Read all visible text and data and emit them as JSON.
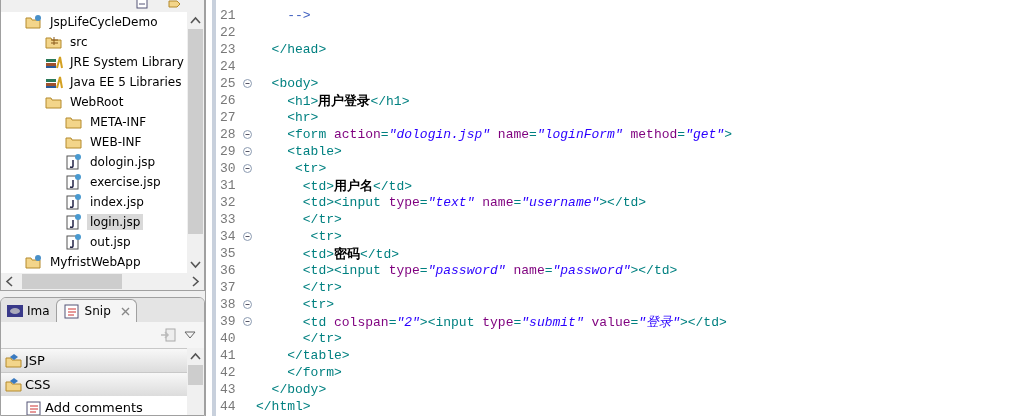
{
  "explorer": {
    "tree": [
      {
        "label": "JspLifeCycleDemo",
        "kind": "project",
        "selected": false,
        "children": [
          {
            "label": "src",
            "kind": "package",
            "selected": false
          },
          {
            "label": "JRE System Library",
            "kind": "library",
            "selected": false
          },
          {
            "label": "Java EE 5 Libraries",
            "kind": "library",
            "selected": false
          },
          {
            "label": "WebRoot",
            "kind": "folder",
            "selected": false,
            "children": [
              {
                "label": "META-INF",
                "kind": "folder",
                "selected": false
              },
              {
                "label": "WEB-INF",
                "kind": "folder",
                "selected": false
              },
              {
                "label": "dologin.jsp",
                "kind": "jsp",
                "selected": false
              },
              {
                "label": "exercise.jsp",
                "kind": "jsp",
                "selected": false
              },
              {
                "label": "index.jsp",
                "kind": "jsp",
                "selected": false
              },
              {
                "label": "login.jsp",
                "kind": "jsp",
                "selected": true
              },
              {
                "label": "out.jsp",
                "kind": "jsp",
                "selected": false
              }
            ]
          }
        ]
      },
      {
        "label": "MyfristWebApp",
        "kind": "project",
        "selected": false
      }
    ]
  },
  "bottom_panel": {
    "tabs": [
      {
        "label": "Ima",
        "selected": false
      },
      {
        "label": "Snip",
        "selected": true
      }
    ],
    "items": [
      {
        "label": "JSP",
        "kind": "category"
      },
      {
        "label": "CSS",
        "kind": "category"
      },
      {
        "label": "Add comments",
        "kind": "snippet"
      }
    ]
  },
  "editor": {
    "lines": [
      {
        "number": "21",
        "fold": false,
        "segments": [
          {
            "kind": "comment",
            "text": "    -->"
          }
        ]
      },
      {
        "number": "22",
        "fold": false
      },
      {
        "number": "23",
        "fold": false,
        "segments": [
          {
            "kind": "tag",
            "text": "  </head>"
          }
        ]
      },
      {
        "number": "24",
        "fold": false
      },
      {
        "number": "25",
        "fold": true,
        "segments": [
          {
            "kind": "tag",
            "text": "  <body>"
          }
        ]
      },
      {
        "number": "26",
        "fold": false,
        "segments": [
          {
            "kind": "tag",
            "text": "    <h1>"
          },
          {
            "kind": "text",
            "text": "用户登录"
          },
          {
            "kind": "tag",
            "text": "</h1>"
          }
        ]
      },
      {
        "number": "27",
        "fold": false,
        "segments": [
          {
            "kind": "tag",
            "text": "    <hr>"
          }
        ]
      },
      {
        "number": "28",
        "fold": true,
        "segments": [
          {
            "kind": "tag",
            "text": "    <form "
          },
          {
            "kind": "attr",
            "text": "action"
          },
          {
            "kind": "tag",
            "text": "="
          },
          {
            "kind": "value",
            "text": "\"dologin.jsp\""
          },
          {
            "kind": "attr",
            "text": " name"
          },
          {
            "kind": "tag",
            "text": "="
          },
          {
            "kind": "value",
            "text": "\"loginForm\""
          },
          {
            "kind": "attr",
            "text": " method"
          },
          {
            "kind": "tag",
            "text": "="
          },
          {
            "kind": "value",
            "text": "\"get\""
          },
          {
            "kind": "tag",
            "text": ">"
          }
        ]
      },
      {
        "number": "29",
        "fold": true,
        "segments": [
          {
            "kind": "tag",
            "text": "    <table>"
          }
        ]
      },
      {
        "number": "30",
        "fold": true,
        "segments": [
          {
            "kind": "tag",
            "text": "     <tr>"
          }
        ]
      },
      {
        "number": "31",
        "fold": false,
        "segments": [
          {
            "kind": "tag",
            "text": "      <td>"
          },
          {
            "kind": "text",
            "text": "用户名"
          },
          {
            "kind": "tag",
            "text": "</td>"
          }
        ]
      },
      {
        "number": "32",
        "fold": false,
        "segments": [
          {
            "kind": "tag",
            "text": "      <td><input "
          },
          {
            "kind": "attr",
            "text": "type"
          },
          {
            "kind": "tag",
            "text": "="
          },
          {
            "kind": "value",
            "text": "\"text\""
          },
          {
            "kind": "attr",
            "text": " name"
          },
          {
            "kind": "tag",
            "text": "="
          },
          {
            "kind": "value",
            "text": "\"username\""
          },
          {
            "kind": "tag",
            "text": "></td>"
          }
        ]
      },
      {
        "number": "33",
        "fold": false,
        "segments": [
          {
            "kind": "tag",
            "text": "      </tr>"
          }
        ]
      },
      {
        "number": "34",
        "fold": true,
        "segments": [
          {
            "kind": "tag",
            "text": "       <tr>"
          }
        ]
      },
      {
        "number": "35",
        "fold": false,
        "segments": [
          {
            "kind": "tag",
            "text": "      <td>"
          },
          {
            "kind": "text",
            "text": "密码"
          },
          {
            "kind": "tag",
            "text": "</td>"
          }
        ]
      },
      {
        "number": "36",
        "fold": false,
        "segments": [
          {
            "kind": "tag",
            "text": "      <td><input "
          },
          {
            "kind": "attr",
            "text": "type"
          },
          {
            "kind": "tag",
            "text": "="
          },
          {
            "kind": "value",
            "text": "\"password\""
          },
          {
            "kind": "attr",
            "text": " name"
          },
          {
            "kind": "tag",
            "text": "="
          },
          {
            "kind": "value",
            "text": "\"password\""
          },
          {
            "kind": "tag",
            "text": "></td>"
          }
        ]
      },
      {
        "number": "37",
        "fold": false,
        "segments": [
          {
            "kind": "tag",
            "text": "      </tr>"
          }
        ]
      },
      {
        "number": "38",
        "fold": true,
        "segments": [
          {
            "kind": "tag",
            "text": "      <tr>"
          }
        ]
      },
      {
        "number": "39",
        "fold": true,
        "segments": [
          {
            "kind": "tag",
            "text": "      <td "
          },
          {
            "kind": "attr",
            "text": "colspan"
          },
          {
            "kind": "tag",
            "text": "="
          },
          {
            "kind": "value",
            "text": "\"2\""
          },
          {
            "kind": "tag",
            "text": "><input "
          },
          {
            "kind": "attr",
            "text": "type"
          },
          {
            "kind": "tag",
            "text": "="
          },
          {
            "kind": "value",
            "text": "\"submit\""
          },
          {
            "kind": "attr",
            "text": " value"
          },
          {
            "kind": "tag",
            "text": "="
          },
          {
            "kind": "value",
            "text": "\"登录\""
          },
          {
            "kind": "tag",
            "text": "></td>"
          }
        ]
      },
      {
        "number": "40",
        "fold": false,
        "segments": [
          {
            "kind": "tag",
            "text": "      </tr>"
          }
        ]
      },
      {
        "number": "41",
        "fold": false,
        "segments": [
          {
            "kind": "tag",
            "text": "    </table>"
          }
        ]
      },
      {
        "number": "42",
        "fold": false,
        "segments": [
          {
            "kind": "tag",
            "text": "    </form>"
          }
        ]
      },
      {
        "number": "43",
        "fold": false,
        "segments": [
          {
            "kind": "tag",
            "text": "  </body>"
          }
        ]
      },
      {
        "number": "44",
        "fold": false,
        "segments": [
          {
            "kind": "tag",
            "text": "</html>"
          }
        ]
      }
    ]
  }
}
